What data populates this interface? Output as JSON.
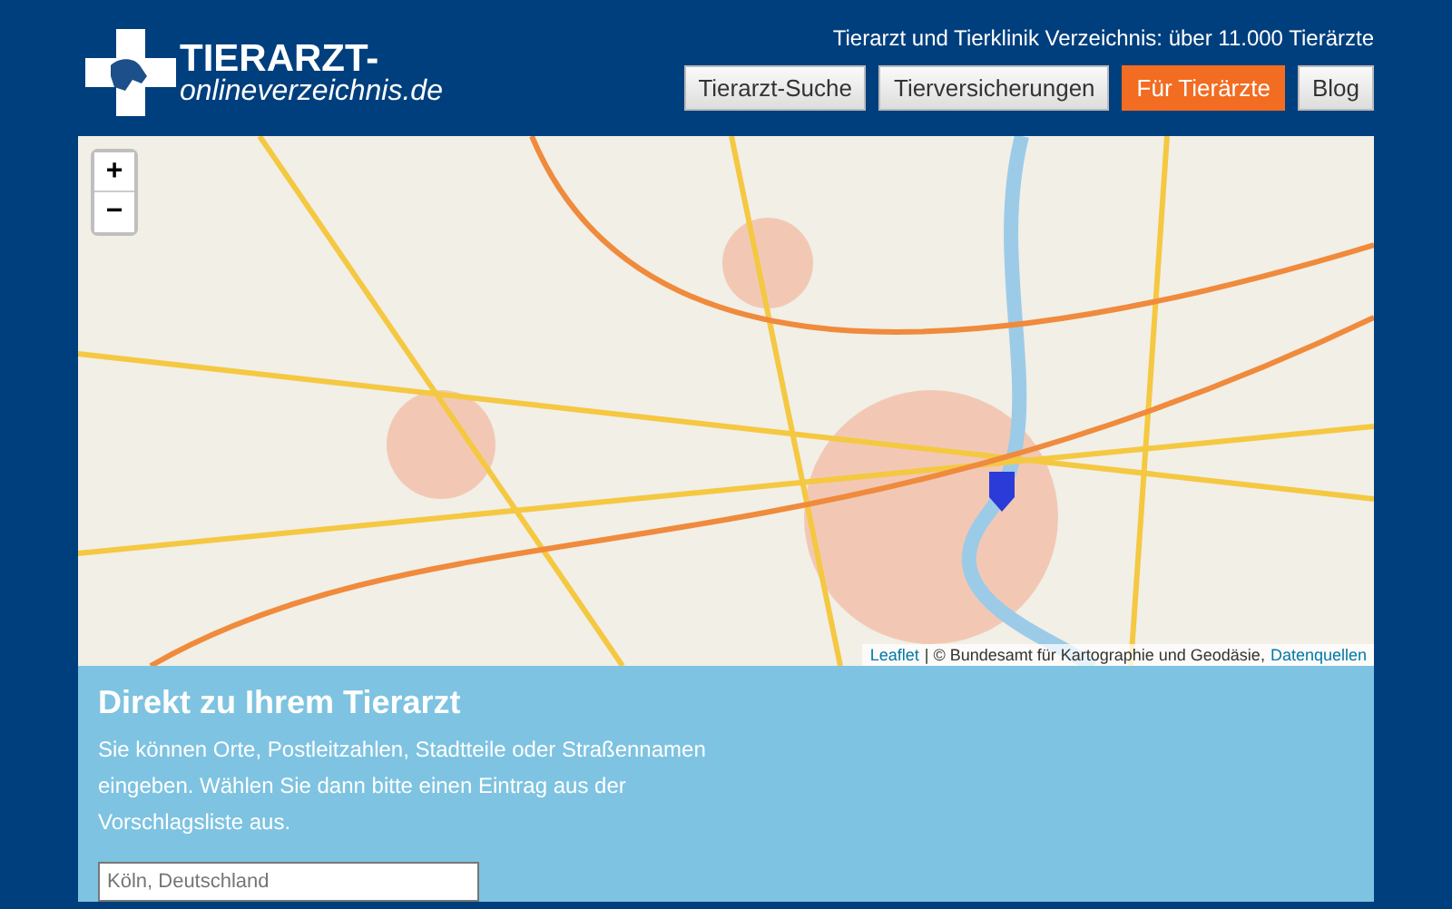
{
  "header": {
    "logo": {
      "line_1": "TIERARZT-",
      "line_2": "onlineverzeichnis.de"
    },
    "tagline": "Tierarzt und Tierklinik Verzeichnis: über 11.000 Tierärzte",
    "nav": [
      {
        "label": "Tierarzt-Suche",
        "selected": false
      },
      {
        "label": "Tierversicherungen",
        "selected": false
      },
      {
        "label": "Für Tierärzte",
        "selected": true
      },
      {
        "label": "Blog",
        "selected": false
      }
    ]
  },
  "map": {
    "zoom_in": "+",
    "zoom_out": "−",
    "attribution": {
      "link": "Leaflet",
      "text": "| © Bundesamt für Kartographie und Geodäsie,",
      "source_link": "Datenquellen"
    }
  },
  "search_panel": {
    "title": "Direkt zu Ihrem Tierarzt",
    "text": "Sie können Orte, Postleitzahlen, Stadtteile oder Straßennamen eingeben. Wählen Sie dann bitte einen Eintrag aus der Vorschlagsliste aus.",
    "input": {
      "placeholder": "Köln, Deutschland"
    }
  }
}
